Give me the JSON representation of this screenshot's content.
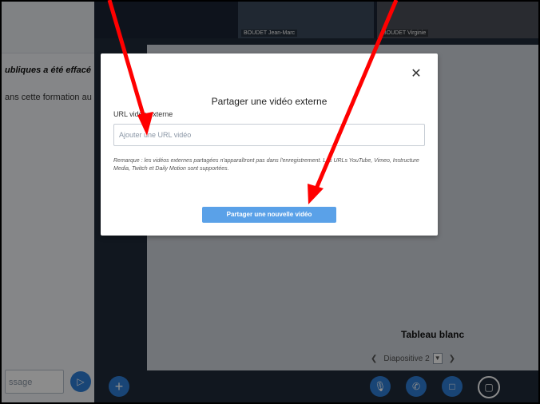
{
  "chat": {
    "message_title": "ubliques a été effacé",
    "message_line": "ans cette formation au",
    "input_placeholder": "ssage"
  },
  "video_strip": {
    "tiles": [
      {
        "name": "BOUDET Jean-Marc"
      },
      {
        "name": "BOUDET Virginie"
      }
    ]
  },
  "presentation": {
    "slide_title": "Tableau blanc",
    "slide_selector": "Diapositive 2",
    "prev_icon": "chevron-left-icon",
    "next_icon": "chevron-right-icon"
  },
  "modal": {
    "title": "Partager une vidéo externe",
    "url_label": "URL vidéo externe",
    "url_placeholder": "Ajouter une URL vidéo",
    "note": "Remarque : les vidéos externes partagées n'apparaîtront pas dans l'enregistrement. Les URLs YouTube, Vimeo, Instructure Media, Twitch et Daily Motion sont supportées.",
    "share_button": "Partager une nouvelle vidéo",
    "close_icon": "close-icon"
  },
  "toolbar": {
    "actions_icon": "plus-icon",
    "mic_icon": "microphone-icon",
    "phone_icon": "phone-icon",
    "camera_icon": "camera-icon",
    "screen_icon": "screen-share-icon"
  },
  "colors": {
    "accent": "#2f7fd7",
    "button": "#5aa1e8",
    "annotation_arrow": "#ff0000"
  }
}
